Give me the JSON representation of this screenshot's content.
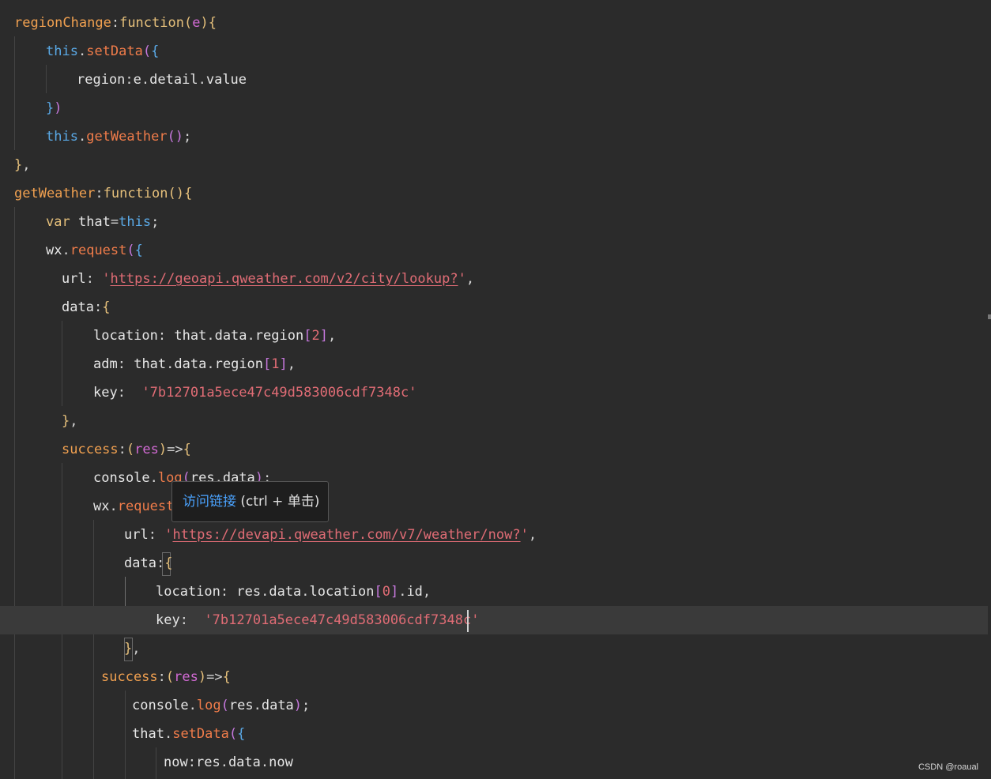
{
  "editor": {
    "lines": [
      [
        [
          "fn",
          "regionChange"
        ],
        [
          "punc",
          ":"
        ],
        [
          "kw",
          "function"
        ],
        [
          "b1",
          "("
        ],
        [
          "param",
          "e"
        ],
        [
          "b1",
          ")"
        ],
        [
          "b1",
          "{"
        ]
      ],
      [
        [
          "this",
          "this"
        ],
        [
          "punc",
          "."
        ],
        [
          "method",
          "setData"
        ],
        [
          "b2",
          "("
        ],
        [
          "b3",
          "{"
        ]
      ],
      [
        [
          "prop",
          "region"
        ],
        [
          "punc",
          ":"
        ],
        [
          "prop",
          "e"
        ],
        [
          "punc",
          "."
        ],
        [
          "prop",
          "detail"
        ],
        [
          "punc",
          "."
        ],
        [
          "prop",
          "value"
        ]
      ],
      [
        [
          "b3",
          "}"
        ],
        [
          "b2",
          ")"
        ]
      ],
      [
        [
          "this",
          "this"
        ],
        [
          "punc",
          "."
        ],
        [
          "method",
          "getWeather"
        ],
        [
          "b2",
          "()"
        ],
        [
          "punc",
          ";"
        ]
      ],
      [
        [
          "b1",
          "}"
        ],
        [
          "punc",
          ","
        ]
      ],
      [
        [
          "fn",
          "getWeather"
        ],
        [
          "punc",
          ":"
        ],
        [
          "kw",
          "function"
        ],
        [
          "b1",
          "()"
        ],
        [
          "b1",
          "{"
        ]
      ],
      [
        [
          "kw",
          "var"
        ],
        [
          "prop",
          " that"
        ],
        [
          "punc",
          "="
        ],
        [
          "this",
          "this"
        ],
        [
          "punc",
          ";"
        ]
      ],
      [
        [
          "prop",
          "wx"
        ],
        [
          "punc",
          "."
        ],
        [
          "method",
          "request"
        ],
        [
          "b2",
          "("
        ],
        [
          "b3",
          "{"
        ]
      ],
      [
        [
          "prop",
          "url"
        ],
        [
          "punc",
          ": "
        ],
        [
          "str",
          "'"
        ],
        [
          "link",
          "https://geoapi.qweather.com/v2/city/lookup?"
        ],
        [
          "str",
          "'"
        ],
        [
          "punc",
          ","
        ]
      ],
      [
        [
          "prop",
          "data"
        ],
        [
          "punc",
          ":"
        ],
        [
          "b1",
          "{"
        ]
      ],
      [
        [
          "prop",
          "location"
        ],
        [
          "punc",
          ": "
        ],
        [
          "prop",
          "that"
        ],
        [
          "punc",
          "."
        ],
        [
          "prop",
          "data"
        ],
        [
          "punc",
          "."
        ],
        [
          "prop",
          "region"
        ],
        [
          "b2",
          "["
        ],
        [
          "num",
          "2"
        ],
        [
          "b2",
          "]"
        ],
        [
          "punc",
          ","
        ]
      ],
      [
        [
          "prop",
          "adm"
        ],
        [
          "punc",
          ": "
        ],
        [
          "prop",
          "that"
        ],
        [
          "punc",
          "."
        ],
        [
          "prop",
          "data"
        ],
        [
          "punc",
          "."
        ],
        [
          "prop",
          "region"
        ],
        [
          "b2",
          "["
        ],
        [
          "num",
          "1"
        ],
        [
          "b2",
          "]"
        ],
        [
          "punc",
          ","
        ]
      ],
      [
        [
          "prop",
          "key"
        ],
        [
          "punc",
          ":  "
        ],
        [
          "str",
          "'7b12701a5ece47c49d583006cdf7348c'"
        ]
      ],
      [
        [
          "b1",
          "}"
        ],
        [
          "punc",
          ","
        ]
      ],
      [
        [
          "fn",
          "success"
        ],
        [
          "punc",
          ":"
        ],
        [
          "b1",
          "("
        ],
        [
          "param",
          "res"
        ],
        [
          "b1",
          ")"
        ],
        [
          "punc",
          "=>"
        ],
        [
          "b1",
          "{"
        ]
      ],
      [
        [
          "prop",
          "console"
        ],
        [
          "punc",
          "."
        ],
        [
          "method",
          "log"
        ],
        [
          "b2",
          "("
        ],
        [
          "prop",
          "res"
        ],
        [
          "punc",
          "."
        ],
        [
          "prop",
          "data"
        ],
        [
          "b2",
          ")"
        ],
        [
          "punc",
          ";"
        ]
      ],
      [
        [
          "prop",
          "wx"
        ],
        [
          "punc",
          "."
        ],
        [
          "method",
          "request"
        ],
        [
          "b2",
          "("
        ],
        [
          "b3",
          "{"
        ]
      ],
      [
        [
          "prop",
          "url"
        ],
        [
          "punc",
          ": "
        ],
        [
          "str",
          "'"
        ],
        [
          "link",
          "https://devapi.qweather.com/v7/weather/now?"
        ],
        [
          "str",
          "'"
        ],
        [
          "punc",
          ","
        ]
      ],
      [
        [
          "prop",
          "data"
        ],
        [
          "punc",
          ":"
        ],
        [
          "b1",
          "{"
        ]
      ],
      [
        [
          "prop",
          "location"
        ],
        [
          "punc",
          ": "
        ],
        [
          "prop",
          "res"
        ],
        [
          "punc",
          "."
        ],
        [
          "prop",
          "data"
        ],
        [
          "punc",
          "."
        ],
        [
          "prop",
          "location"
        ],
        [
          "b2",
          "["
        ],
        [
          "num",
          "0"
        ],
        [
          "b2",
          "]"
        ],
        [
          "punc",
          "."
        ],
        [
          "prop",
          "id"
        ],
        [
          "punc",
          ","
        ]
      ],
      [
        [
          "prop",
          "key"
        ],
        [
          "punc",
          ":  "
        ],
        [
          "str",
          "'7b12701a5ece47c49d583006cdf7348c'"
        ]
      ],
      [
        [
          "b1",
          "}"
        ],
        [
          "punc",
          ","
        ]
      ],
      [
        [
          "fn",
          "success"
        ],
        [
          "punc",
          ":"
        ],
        [
          "b1",
          "("
        ],
        [
          "param",
          "res"
        ],
        [
          "b1",
          ")"
        ],
        [
          "punc",
          "=>"
        ],
        [
          "b1",
          "{"
        ]
      ],
      [
        [
          "prop",
          "console"
        ],
        [
          "punc",
          "."
        ],
        [
          "method",
          "log"
        ],
        [
          "b2",
          "("
        ],
        [
          "prop",
          "res"
        ],
        [
          "punc",
          "."
        ],
        [
          "prop",
          "data"
        ],
        [
          "b2",
          ")"
        ],
        [
          "punc",
          ";"
        ]
      ],
      [
        [
          "prop",
          "that"
        ],
        [
          "punc",
          "."
        ],
        [
          "method",
          "setData"
        ],
        [
          "b2",
          "("
        ],
        [
          "b3",
          "{"
        ]
      ],
      [
        [
          "prop",
          "now"
        ],
        [
          "punc",
          ":"
        ],
        [
          "prop",
          "res"
        ],
        [
          "punc",
          "."
        ],
        [
          "prop",
          "data"
        ],
        [
          "punc",
          "."
        ],
        [
          "prop",
          "now"
        ]
      ]
    ]
  },
  "tooltip": {
    "link_label": "访问链接",
    "hint": " (ctrl + 单击)"
  },
  "watermark": "CSDN @roaual"
}
